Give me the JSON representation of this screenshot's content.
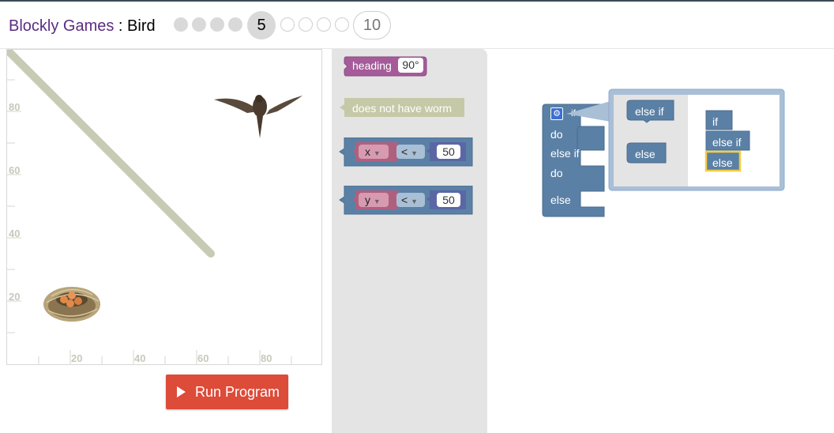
{
  "header": {
    "app_name": "Blockly Games",
    "separator": " : ",
    "game_name": "Bird",
    "levels": [
      "1",
      "2",
      "3",
      "4",
      "5",
      "6",
      "7",
      "8",
      "9",
      "10"
    ],
    "current_level": "5",
    "last_level": "10"
  },
  "stage": {
    "y_ticks": [
      "80",
      "60",
      "40",
      "20"
    ],
    "x_ticks": [
      "20",
      "40",
      "60",
      "80"
    ]
  },
  "run_button": {
    "label": "Run Program"
  },
  "toolbox": {
    "heading_label": "heading",
    "heading_value": "90°",
    "no_worm_label": "does not have worm",
    "compare_x": {
      "var": "x",
      "op": "<",
      "value": "50"
    },
    "compare_y": {
      "var": "y",
      "op": "<",
      "value": "50"
    }
  },
  "workspace": {
    "if_block": {
      "if_label": "if",
      "do1": "do",
      "elseif_label": "else if",
      "do2": "do",
      "else_label": "else"
    },
    "mutator": {
      "left_elseif": "else if",
      "left_else": "else",
      "right_if": "if",
      "right_elseif": "else if",
      "right_else": "else"
    }
  },
  "colors": {
    "logic_blue": "#5b80a5",
    "heading_purple": "#a55b99",
    "worm_tan": "#c6c9a7",
    "var_pink": "#b0607f",
    "run_red": "#dd4b39",
    "path_line": "#c8cbb4"
  }
}
